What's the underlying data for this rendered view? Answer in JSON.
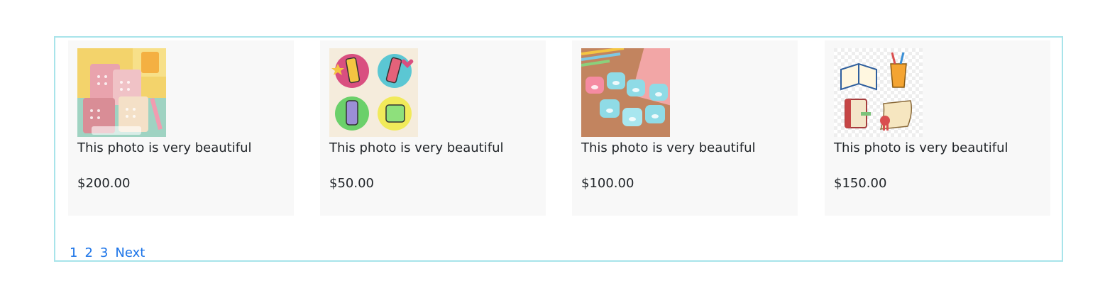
{
  "products": [
    {
      "image_icon": "pencil-cups-photo",
      "caption": "This photo is very beautiful",
      "price": "$200.00"
    },
    {
      "image_icon": "cartoon-stationery-photo",
      "caption": "This photo is very beautiful",
      "price": "$50.00"
    },
    {
      "image_icon": "pig-sharpeners-photo",
      "caption": "This photo is very beautiful",
      "price": "$100.00"
    },
    {
      "image_icon": "books-and-scroll-photo",
      "caption": "This photo is very beautiful",
      "price": "$150.00"
    }
  ],
  "pagination": {
    "pages": [
      "1",
      "2",
      "3"
    ],
    "next_label": "Next"
  },
  "colors": {
    "frame_border": "#a8e4ea",
    "card_bg": "#f8f8f8",
    "link": "#1a73e8"
  }
}
